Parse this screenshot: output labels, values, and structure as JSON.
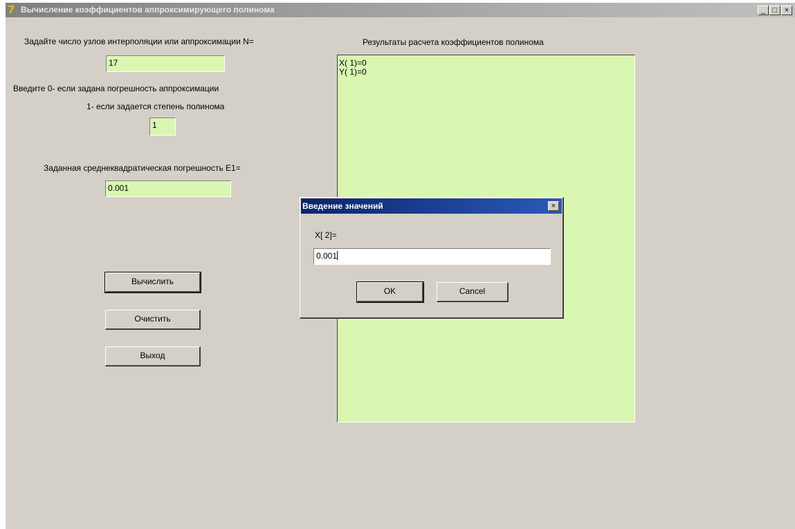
{
  "window": {
    "title": "Вычисление коэффициентов аппроксимирующего полинома",
    "icon": "app-icon",
    "controls": {
      "minimize": "_",
      "maximize": "□",
      "close": "×"
    }
  },
  "form": {
    "nodes_label": "Задайте число узлов интерполяции или аппроксимации N=",
    "nodes_value": "17",
    "mode_label_0": "Введите 0- если задана погрешность аппроксимации",
    "mode_label_1": "1- если задается степень полинома",
    "mode_value": "1",
    "error_label": "Заданная среднеквадратическая погрешность E1=",
    "error_value": "0.001"
  },
  "buttons": {
    "compute": "Вычислить",
    "clear": "Очистить",
    "exit": "Выход"
  },
  "results": {
    "label": "Результаты расчета коэффициентов полинома",
    "lines": [
      "X( 1)=0",
      "Y( 1)=0"
    ]
  },
  "dialog": {
    "title": "Введение значений",
    "prompt": "X[ 2]=",
    "input_value": "0.001",
    "ok": "OK",
    "cancel": "Cancel",
    "close": "×"
  },
  "colors": {
    "field_bg": "#d9f7b0",
    "window_bg": "#d4d0c8",
    "dialog_title": "#0a246a"
  }
}
